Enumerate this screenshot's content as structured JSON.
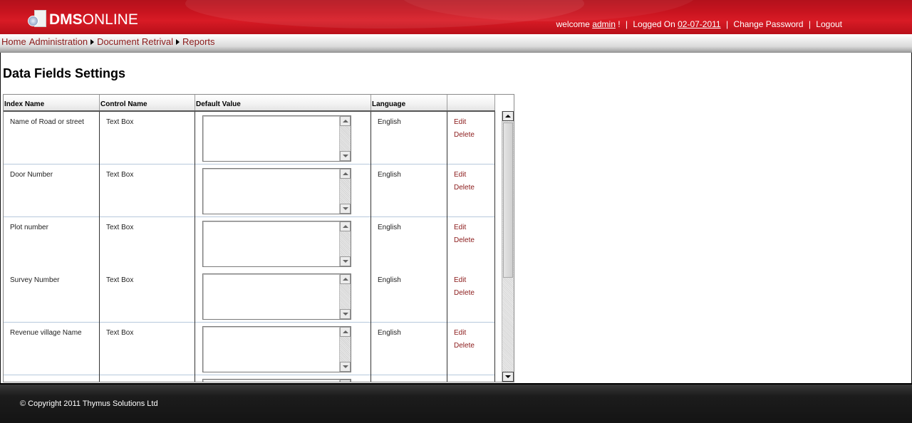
{
  "header": {
    "logo_bold": "DMS",
    "logo_regular": "ONLINE",
    "welcome_label": "welcome",
    "username": "admin",
    "username_suffix": "!",
    "logged_on_label": "Logged On",
    "logged_on_date": "02-07-2011",
    "change_password": "Change Password",
    "logout": "Logout"
  },
  "nav": {
    "items": [
      {
        "label": "Home"
      },
      {
        "label": "Administration"
      },
      {
        "label": "Document Retrival"
      },
      {
        "label": "Reports"
      }
    ]
  },
  "page": {
    "title": "Data Fields Settings"
  },
  "grid": {
    "columns": [
      "Index Name",
      "Control Name",
      "Default Value",
      "Language",
      ""
    ],
    "rows": [
      {
        "index_name": "Name of Road or street",
        "control_name": "Text Box",
        "default_value": "",
        "language": "English",
        "edit": "Edit",
        "delete": "Delete"
      },
      {
        "index_name": "Door Number",
        "control_name": "Text Box",
        "default_value": "",
        "language": "English",
        "edit": "Edit",
        "delete": "Delete"
      },
      {
        "index_name": "Plot number",
        "control_name": "Text Box",
        "default_value": "",
        "language": "English",
        "edit": "Edit",
        "delete": "Delete"
      },
      {
        "index_name": "Survey Number",
        "control_name": "Text Box",
        "default_value": "",
        "language": "English",
        "edit": "Edit",
        "delete": "Delete"
      },
      {
        "index_name": "Revenue village Name",
        "control_name": "Text Box",
        "default_value": "",
        "language": "English",
        "edit": "Edit",
        "delete": "Delete"
      },
      {
        "index_name": "",
        "control_name": "",
        "default_value": "",
        "language": "",
        "edit": "",
        "delete": ""
      }
    ]
  },
  "footer": {
    "copyright": "© Copyright 2011 Thymus Solutions Ltd"
  }
}
